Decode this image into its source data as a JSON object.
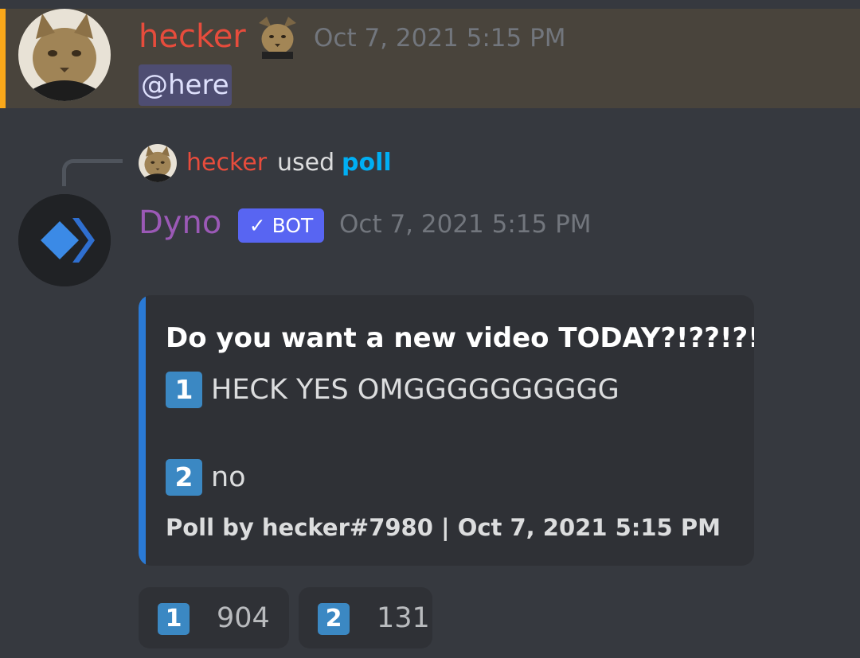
{
  "messages": {
    "mention_message": {
      "author": "hecker",
      "author_color": "#e74c3c",
      "badge_icon": "cat-emoji-icon",
      "timestamp": "Oct 7, 2021 5:15 PM",
      "content": "@here",
      "highlight_color": "#faa81a"
    },
    "bot_message": {
      "reply": {
        "user": "hecker",
        "used_text": "used",
        "command": "poll"
      },
      "author": "Dyno",
      "author_color": "#9b59b6",
      "bot_tag": "✓ BOT",
      "timestamp": "Oct 7, 2021 5:15 PM",
      "embed": {
        "accent_color": "#2a7ad6",
        "title": "Do you want a new video TODAY?!??!?!",
        "options": [
          {
            "key": "1",
            "text": "HECK YES OMGGGGGGGGGG"
          },
          {
            "key": "2",
            "text": "no"
          }
        ],
        "footer": "Poll by hecker#7980 | Oct 7, 2021 5:15 PM"
      },
      "reactions": [
        {
          "key": "1",
          "count": "904"
        },
        {
          "key": "2",
          "count": "131"
        }
      ]
    }
  },
  "icons": {
    "user_avatar": "cat-avatar-icon",
    "bot_avatar": "dyno-logo-icon"
  }
}
